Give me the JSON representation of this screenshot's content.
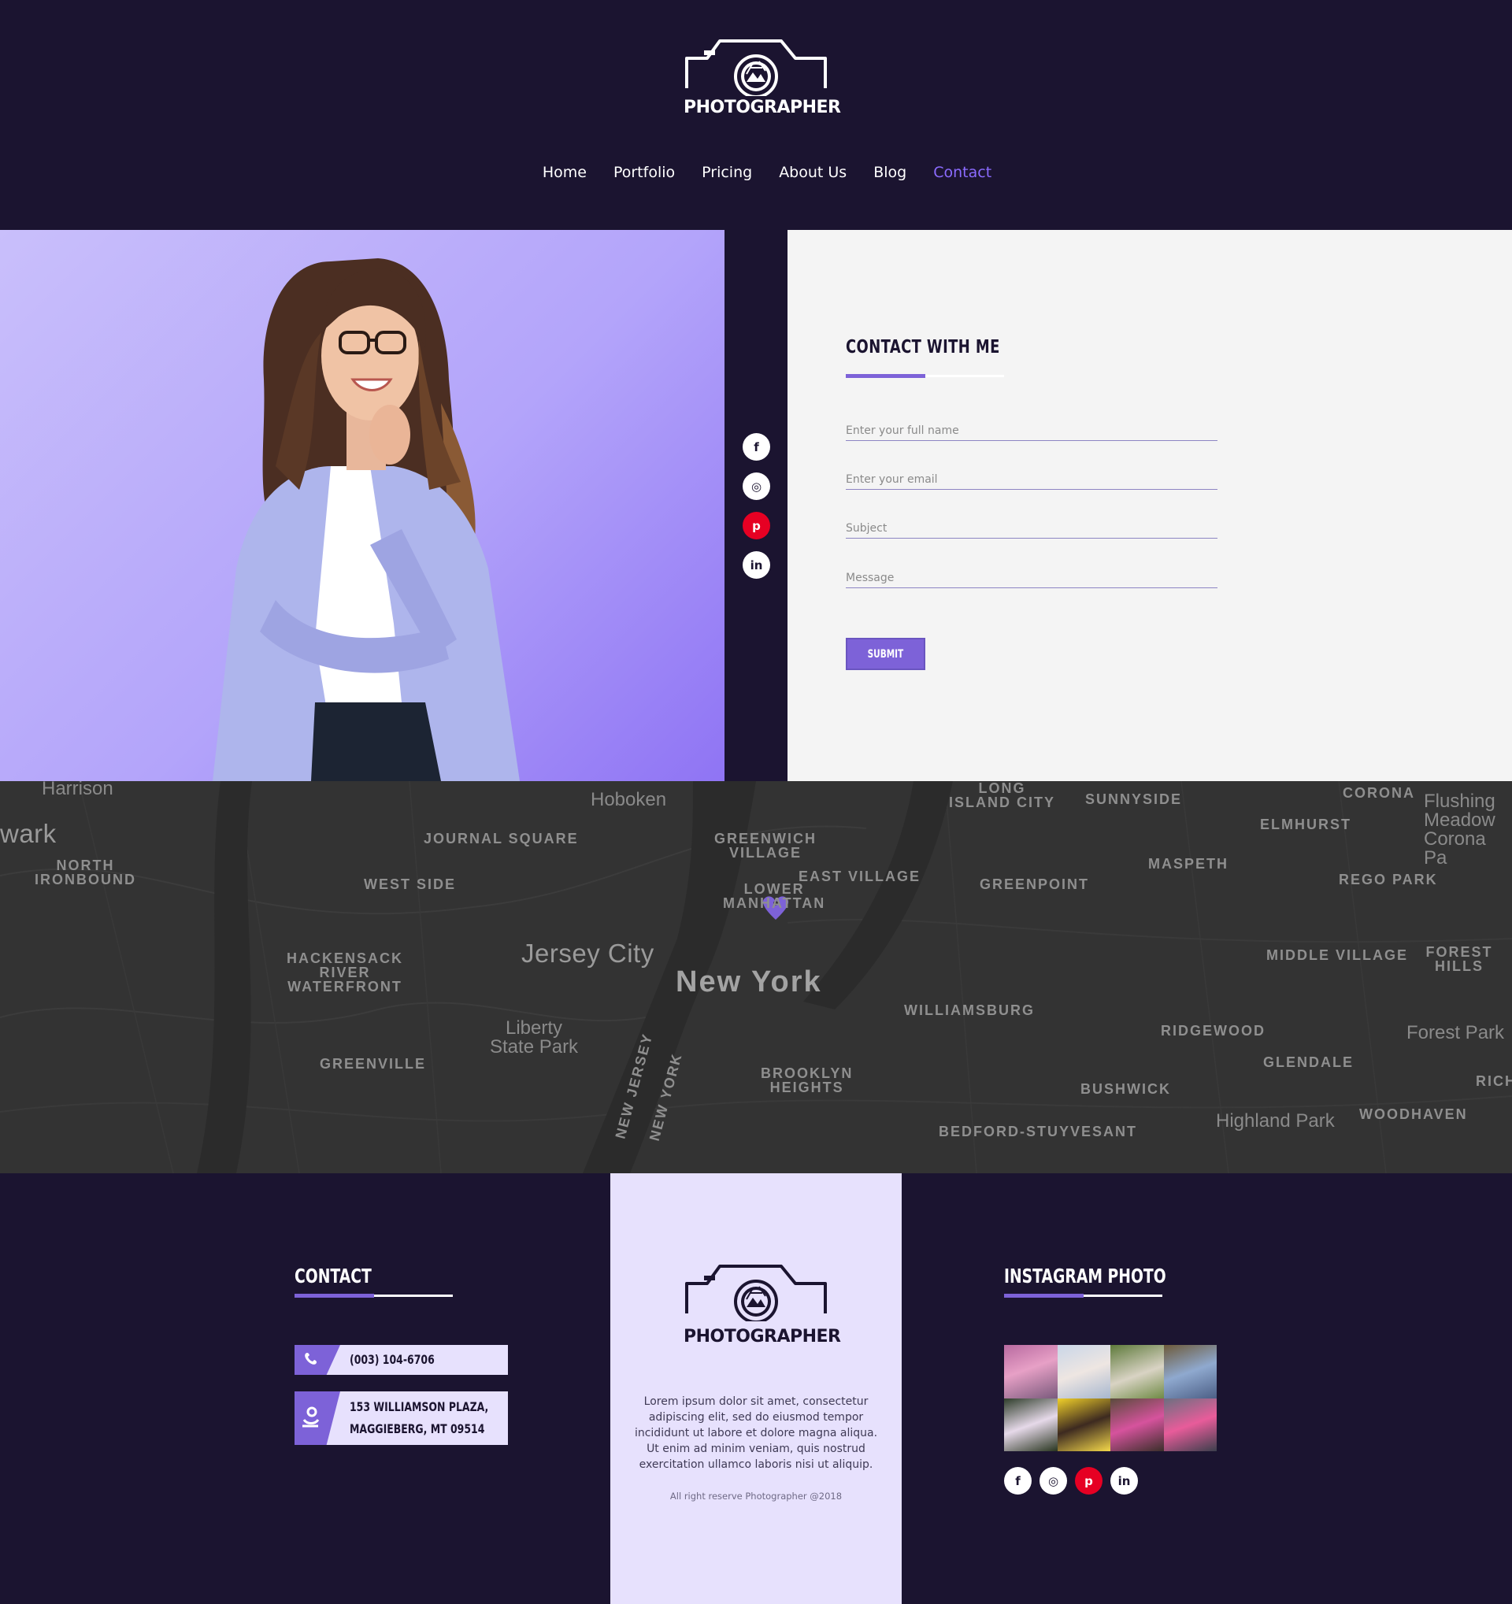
{
  "brand": {
    "name": "PHOTOGRAPHER"
  },
  "nav": {
    "items": [
      {
        "label": "Home"
      },
      {
        "label": "Portfolio"
      },
      {
        "label": "Pricing"
      },
      {
        "label": "About Us"
      },
      {
        "label": "Blog"
      },
      {
        "label": "Contact",
        "active": true
      }
    ]
  },
  "social": {
    "icons": [
      "facebook-icon",
      "instagram-icon",
      "pinterest-icon",
      "linkedin-icon"
    ],
    "glyphs": [
      "f",
      "◎",
      "p",
      "in"
    ]
  },
  "contact_form": {
    "title": "CONTACT WITH ME",
    "name_placeholder": "Enter your full name",
    "email_placeholder": "Enter your email",
    "subject_placeholder": "Subject",
    "message_placeholder": "Message",
    "submit_label": "SUBMIT"
  },
  "map": {
    "labels": {
      "harrison": "Harrison",
      "hoboken": "Hoboken",
      "lic": "LONG\nISLAND CITY",
      "sunnyside": "SUNNYSIDE",
      "corona": "CORONA",
      "flushing": "Flushing\nMeadow\nCorona Pa",
      "newark": "wark",
      "journal": "JOURNAL SQUARE",
      "greenwich": "GREENWICH\nVILLAGE",
      "elmhurst": "ELMHURST",
      "north_ironbound": "NORTH\nIRONBOUND",
      "maspeth": "MASPETH",
      "west_side": "WEST SIDE",
      "east_village": "EAST VILLAGE",
      "greenpoint": "GREENPOINT",
      "rego_park": "REGO PARK",
      "lower_manhattan": "LOWER\nMANHATTAN",
      "hackensack": "HACKENSACK\nRIVER\nWATERFRONT",
      "jersey_city": "Jersey City",
      "new_york": "New York",
      "middle_village": "MIDDLE VILLAGE",
      "forest_hills": "FOREST HILLS",
      "williamsburg": "WILLIAMSBURG",
      "liberty": "Liberty\nState Park",
      "ridgewood": "RIDGEWOOD",
      "forest_park": "Forest Park",
      "glendale": "GLENDALE",
      "greenville": "GREENVILLE",
      "new_jersey": "NEW JERSEY",
      "new_york_state": "NEW YORK",
      "brooklyn_heights": "BROOKLYN\nHEIGHTS",
      "rich": "RICH",
      "bushwick": "BUSHWICK",
      "highland_park": "Highland Park",
      "woodhaven": "WOODHAVEN",
      "bed_stuy": "BEDFORD-STUYVESANT"
    },
    "pin_color": "#7d62d8"
  },
  "footer": {
    "contact_title": "CONTACT",
    "phone": "(003) 104-6706",
    "address_line1": "153 WILLIAMSON PLAZA,",
    "address_line2": "MAGGIEBERG, MT 09514",
    "about": "Lorem ipsum dolor sit amet, consectetur adipiscing elit, sed do eiusmod tempor incididunt ut labore et dolore magna aliqua. Ut enim ad minim veniam, quis nostrud exercitation ullamco laboris nisi ut aliquip.",
    "copyright": "All right reserve Photographer @2018",
    "instagram_title": "INSTAGRAM PHOTO"
  },
  "colors": {
    "accent": "#7d62d8",
    "nav_active": "#8b6bff",
    "dark_bg": "#1b1430",
    "pinterest": "#e60023"
  }
}
